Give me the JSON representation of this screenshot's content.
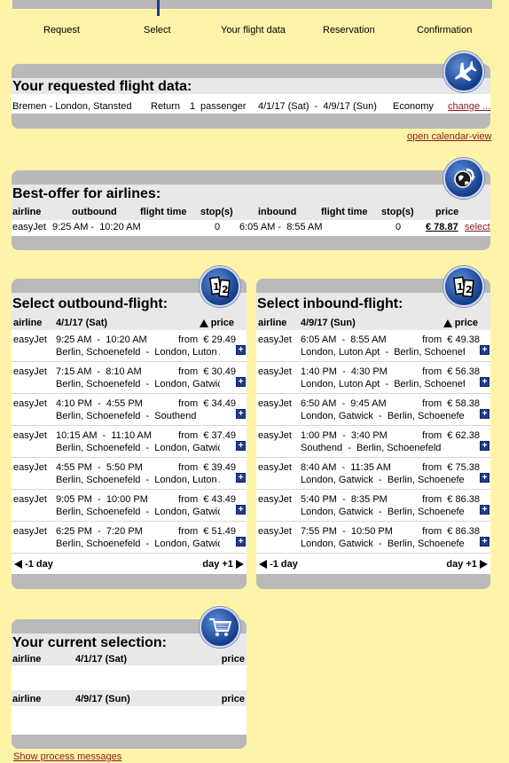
{
  "steps": [
    "Request",
    "Select",
    "Your flight data",
    "Reservation",
    "Confirmation"
  ],
  "requested": {
    "title": "Your requested flight data:",
    "route": "Bremen - London, Stansted",
    "trip_type": "Return",
    "passengers_count": "1",
    "passengers_label": "passenger",
    "dates": "4/1/17 (Sat)  -  4/9/17 (Sun)",
    "cabin": "Economy",
    "change_link": "change ...",
    "calendar_link": "open calendar-view"
  },
  "best_offer": {
    "title": "Best-offer for airlines:",
    "headers": {
      "airline": "airline",
      "outbound": "outbound",
      "flight_time_out": "flight time",
      "stops_out": "stop(s)",
      "inbound": "inbound",
      "flight_time_in": "flight time",
      "stops_in": "stop(s)",
      "price": "price"
    },
    "row": {
      "airline": "easyJet",
      "outbound": "9:25 AM -  10:20 AM",
      "stops_out": "0",
      "inbound": "6:05 AM -  8:55 AM",
      "stops_in": "0",
      "price": "€ 78.87",
      "select": "select"
    }
  },
  "outbound": {
    "title": "Select outbound-flight:",
    "col_airline": "airline",
    "date": "4/1/17 (Sat)",
    "col_price": "price",
    "flights": [
      {
        "airline": "easyJet",
        "times": "9:25 AM  -  10:20 AM",
        "price": "from  € 29.49",
        "route": "Berlin, Schoenefeld  -  London, Luton Apt"
      },
      {
        "airline": "easyJet",
        "times": "7:15 AM  -  8:10 AM",
        "price": "from  € 30.49",
        "route": "Berlin, Schoenefeld  -  London, Gatwick"
      },
      {
        "airline": "easyJet",
        "times": "4:10 PM  -  4:55 PM",
        "price": "from  € 34.49",
        "route": "Berlin, Schoenefeld  -  Southend"
      },
      {
        "airline": "easyJet",
        "times": "10:15 AM  -  11:10 AM",
        "price": "from  € 37.49",
        "route": "Berlin, Schoenefeld  -  London, Gatwick"
      },
      {
        "airline": "easyJet",
        "times": "4:55 PM  -  5:50 PM",
        "price": "from  € 39.49",
        "route": "Berlin, Schoenefeld  -  London, Luton Apt"
      },
      {
        "airline": "easyJet",
        "times": "9:05 PM  -  10:00 PM",
        "price": "from  € 43.49",
        "route": "Berlin, Schoenefeld  -  London, Gatwick"
      },
      {
        "airline": "easyJet",
        "times": "6:25 PM  -  7:20 PM",
        "price": "from  € 51.49",
        "route": "Berlin, Schoenefeld  -  London, Gatwick"
      }
    ],
    "prev_day": "-1 day",
    "next_day": "day +1"
  },
  "inbound": {
    "title": "Select inbound-flight:",
    "col_airline": "airline",
    "date": "4/9/17 (Sun)",
    "col_price": "price",
    "flights": [
      {
        "airline": "easyJet",
        "times": "6:05 AM  -  8:55 AM",
        "price": "from  € 49.38",
        "route": "London, Luton Apt  -  Berlin, Schoenefeld"
      },
      {
        "airline": "easyJet",
        "times": "1:40 PM  -  4:30 PM",
        "price": "from  € 56.38",
        "route": "London, Luton Apt  -  Berlin, Schoenefeld"
      },
      {
        "airline": "easyJet",
        "times": "6:50 AM  -  9:45 AM",
        "price": "from  € 58.38",
        "route": "London, Gatwick  -  Berlin, Schoenefeld"
      },
      {
        "airline": "easyJet",
        "times": "1:00 PM  -  3:40 PM",
        "price": "from  € 62.38",
        "route": "Southend  -  Berlin, Schoenefeld"
      },
      {
        "airline": "easyJet",
        "times": "8:40 AM  -  11:35 AM",
        "price": "from  € 75.38",
        "route": "London, Gatwick  -  Berlin, Schoenefeld"
      },
      {
        "airline": "easyJet",
        "times": "5:40 PM  -  8:35 PM",
        "price": "from  € 86.38",
        "route": "London, Gatwick  -  Berlin, Schoenefeld"
      },
      {
        "airline": "easyJet",
        "times": "7:55 PM  -  10:50 PM",
        "price": "from  € 86.38",
        "route": "London, Gatwick  -  Berlin, Schoenefeld"
      }
    ],
    "prev_day": "-1 day",
    "next_day": "day +1"
  },
  "selection": {
    "title": "Your current selection:",
    "out_airline": "airline",
    "out_date": "4/1/17 (Sat)",
    "out_price": "price",
    "in_airline": "airline",
    "in_date": "4/9/17 (Sun)",
    "in_price": "price"
  },
  "footer_link": "Show process messages",
  "colors": {
    "background": "#fdf3a9",
    "panel_frame": "#b9b9b9",
    "badge": "#123c8c",
    "link": "#8a1a1a"
  },
  "icons": {
    "requested": "airplane-icon",
    "best_offer": "globe-arrow-icon",
    "outbound": "one-two-icon",
    "inbound": "one-two-icon",
    "selection": "shopping-cart-icon"
  }
}
